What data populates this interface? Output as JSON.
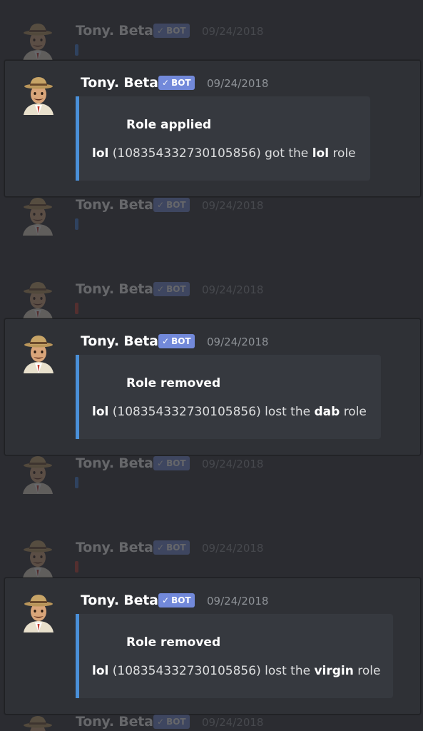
{
  "colors": {
    "background": "#2b2c31",
    "card": "#2f3136",
    "embed_bg": "#36393f",
    "embed_accent": "#4a90d9",
    "bot_badge": "#7289da",
    "stub_blue": "#3c7bd6",
    "stub_red": "#c0392b"
  },
  "bot_badge": {
    "check": "✓",
    "label": "BOT"
  },
  "ghost_messages": [
    {
      "author": "Tony. Beta",
      "timestamp": "09/24/2018",
      "stub_color": "blue"
    },
    {
      "author": "Tony. Beta",
      "timestamp": "09/24/2018",
      "stub_color": "blue"
    },
    {
      "author": "Tony. Beta",
      "timestamp": "09/24/2018",
      "stub_color": "red"
    },
    {
      "author": "Tony. Beta",
      "timestamp": "09/24/2018",
      "stub_color": "blue"
    },
    {
      "author": "Tony. Beta",
      "timestamp": "09/24/2018",
      "stub_color": "red"
    },
    {
      "author": "Tony. Beta",
      "timestamp": "09/24/2018",
      "stub_color": "blue"
    }
  ],
  "messages": [
    {
      "author": "Tony. Beta",
      "timestamp": "09/24/2018",
      "embed": {
        "title": "Role applied",
        "user": "lol",
        "id": "(108354332730105856)",
        "action": "got the",
        "role": "lol",
        "suffix": "role"
      }
    },
    {
      "author": "Tony. Beta",
      "timestamp": "09/24/2018",
      "embed": {
        "title": "Role removed",
        "user": "lol",
        "id": "(108354332730105856)",
        "action": "lost the",
        "role": "dab",
        "suffix": "role"
      }
    },
    {
      "author": "Tony. Beta",
      "timestamp": "09/24/2018",
      "embed": {
        "title": "Role removed",
        "user": "lol",
        "id": "(108354332730105856)",
        "action": "lost the",
        "role": "virgin",
        "suffix": "role"
      }
    }
  ]
}
